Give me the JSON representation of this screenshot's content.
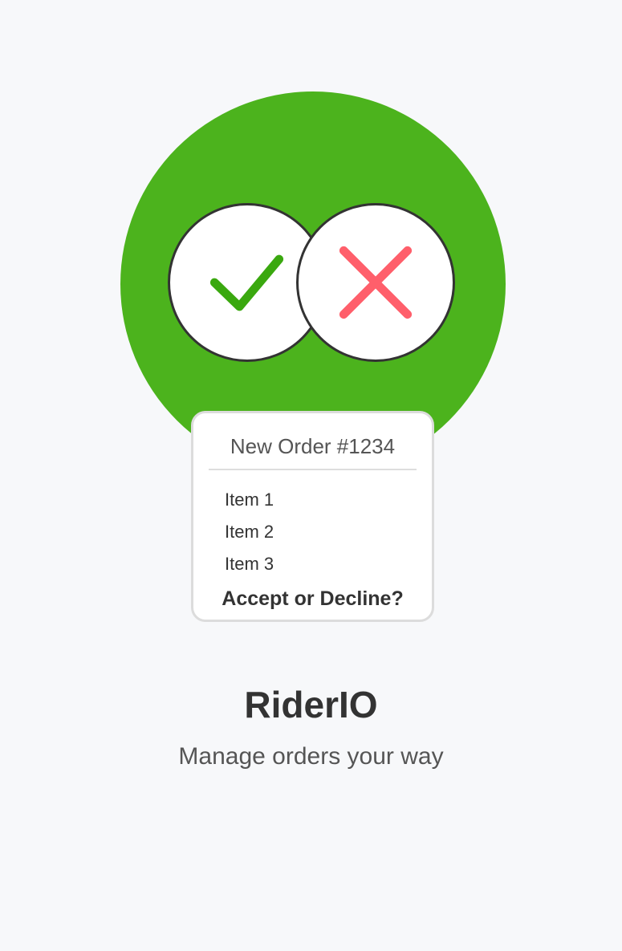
{
  "hero": {
    "accent_color": "#4cb31d",
    "accept_icon": "check-icon",
    "accept_color": "#3aa80f",
    "decline_icon": "close-icon",
    "decline_color": "#ff5f6b"
  },
  "order": {
    "title": "New Order #1234",
    "items": [
      "Item 1",
      "Item 2",
      "Item 3"
    ],
    "question": "Accept or Decline?"
  },
  "app": {
    "name": "RiderIO",
    "tagline": "Manage orders your way"
  }
}
